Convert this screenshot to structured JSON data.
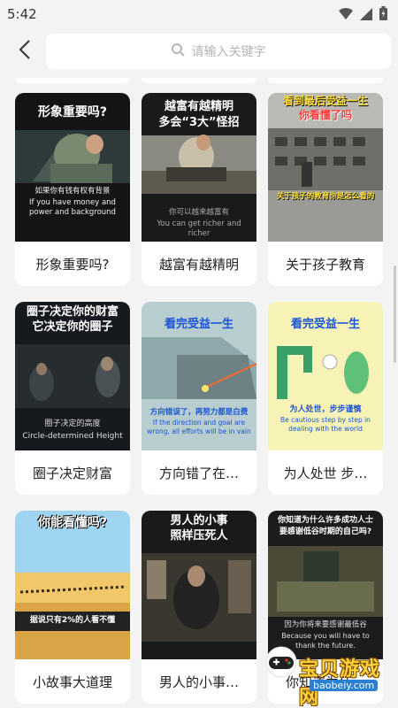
{
  "status": {
    "time": "5:42"
  },
  "search": {
    "placeholder": "请输入关键字"
  },
  "cards": [
    {
      "title": "形象重要吗?",
      "headline": "形象重要吗?",
      "caption_cn": "如果你有钱有权有背景",
      "caption_en": "If you have money and power and background"
    },
    {
      "title": "越富有越精明",
      "headline_1": "越富有越精明",
      "headline_2": "多会“3大”怪招",
      "caption_cn": "你可以越来越富有",
      "caption_en": "You can get richer and richer"
    },
    {
      "title": "关于孩子教育",
      "headline_1": "看到最后受益一生",
      "headline_2": "你看懂了吗",
      "caption_cn": "关于孩子的教育你是怎么看的"
    },
    {
      "title": "圈子决定财富",
      "headline_1": "圈子决定你的财富",
      "headline_2": "它决定你的圈子",
      "caption_cn": "圈子决定的高度",
      "caption_en": "Circle-determined Height"
    },
    {
      "title": "方向错了在…",
      "headline": "看完受益一生",
      "caption_cn": "方向错误了，再努力都是白费",
      "caption_en": "If the direction and goal are wrong, all efforts will be in vain"
    },
    {
      "title": "为人处世 步…",
      "headline": "看完受益一生",
      "caption_cn": "为人处世，步步谨慎",
      "caption_en": "Be cautious step by step in dealing with the world"
    },
    {
      "title": "小故事大道理",
      "headline": "你能看懂吗?",
      "caption_cn": "据说只有2%的人看不懂"
    },
    {
      "title": "男人的小事…",
      "headline_1": "男人的小事",
      "headline_2": "照样压死人"
    },
    {
      "title": "你知道为什…",
      "headline_1": "你知道为什么许多成功人士",
      "headline_2": "要感谢低谷时期的自己吗?",
      "caption_cn": "因为你将来要感谢最低谷",
      "caption_en": "Because you will have to thank the future."
    }
  ],
  "watermark": {
    "text": "宝贝游戏网",
    "url": "baobeiy.com"
  }
}
